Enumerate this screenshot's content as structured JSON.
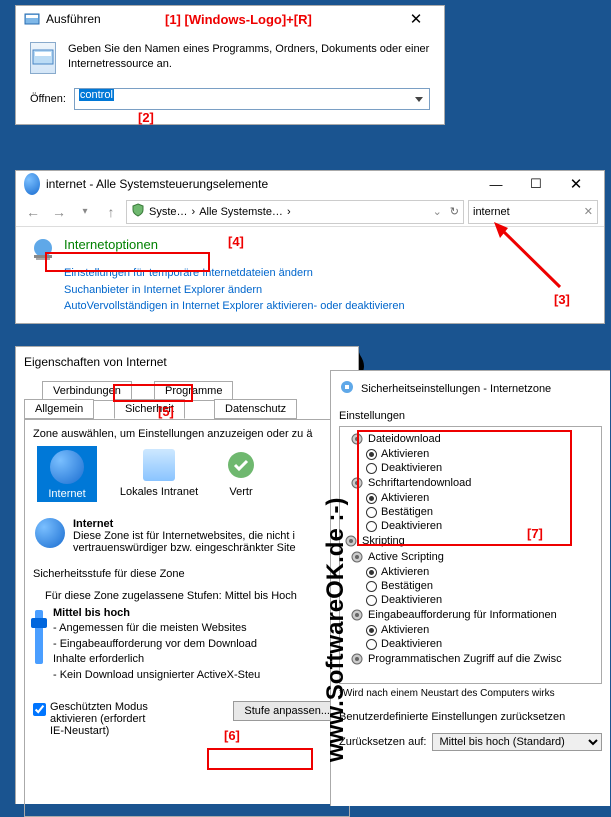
{
  "run": {
    "title": "Ausführen",
    "marker1": "[1]  [Windows-Logo]+[R]",
    "desc": "Geben Sie den Namen eines Programms, Ordners, Dokuments oder einer Internetressource an.",
    "open_label": "Öffnen:",
    "open_value": "control",
    "marker2": "[2]"
  },
  "cp": {
    "title": "internet - Alle Systemsteuerungselemente",
    "bc1": "Syste…",
    "bc2": "Alle Systemste…",
    "search": "internet",
    "marker4": "[4]",
    "marker3": "[3]",
    "item_title": "Internetoptionen",
    "link1": "Einstellungen für temporäre Internetdateien ändern",
    "link2": "Suchanbieter in Internet Explorer ändern",
    "link3": "AutoVervollständigen in Internet Explorer aktivieren- oder deaktivieren"
  },
  "props": {
    "title": "Eigenschaften von Internet",
    "tabs": {
      "verbindungen": "Verbindungen",
      "programme": "Programme",
      "allgemein": "Allgemein",
      "sicherheit": "Sicherheit",
      "datenschutz": "Datenschutz"
    },
    "marker5": "[5]",
    "zone_hint": "Zone auswählen, um Einstellungen anzuzeigen oder zu ä",
    "zones": {
      "internet": "Internet",
      "intranet": "Lokales Intranet",
      "vertrau": "Vertr"
    },
    "zone_desc_title": "Internet",
    "zone_desc_text": "Diese Zone ist für Internetwebsites, die nicht i\nvertrauenswürdiger bzw. eingeschränkter Site",
    "level_title": "Sicherheitsstufe für diese Zone",
    "level_allowed": "Für diese Zone zugelassene Stufen: Mittel bis Hoch",
    "level_name": "Mittel bis hoch",
    "level_b1": "- Angemessen für die meisten Websites",
    "level_b2": "- Eingabeaufforderung vor dem Download\n  Inhalte erforderlich",
    "level_b3": "- Kein Download unsignierter ActiveX-Steu",
    "protected": "Geschützten Modus\naktivieren (erfordert\nIE-Neustart)",
    "marker6": "[6]",
    "btn_stufe": "Stufe anpassen..."
  },
  "sec": {
    "title": "Sicherheitseinstellungen - Internetzone",
    "einstellungen": "Einstellungen",
    "marker7": "[7]",
    "items": {
      "dateidownload": "Dateidownload",
      "aktivieren": "Aktivieren",
      "deaktivieren": "Deaktivieren",
      "schriftarten": "Schriftartendownload",
      "bestatigen": "Bestätigen",
      "skripting": "Skripting",
      "active_scripting": "Active Scripting",
      "eingabe": "Eingabeaufforderung für Informationen",
      "prog": "Programmatischen Zugriff auf die Zwisc"
    },
    "note": "*Wird nach einem Neustart des Computers wirks",
    "reset_title": "Benutzerdefinierte Einstellungen zurücksetzen",
    "reset_label": "Zurücksetzen auf:",
    "reset_value": "Mittel bis hoch (Standard)"
  },
  "watermark": "www.SoftwareOK.de :-)"
}
